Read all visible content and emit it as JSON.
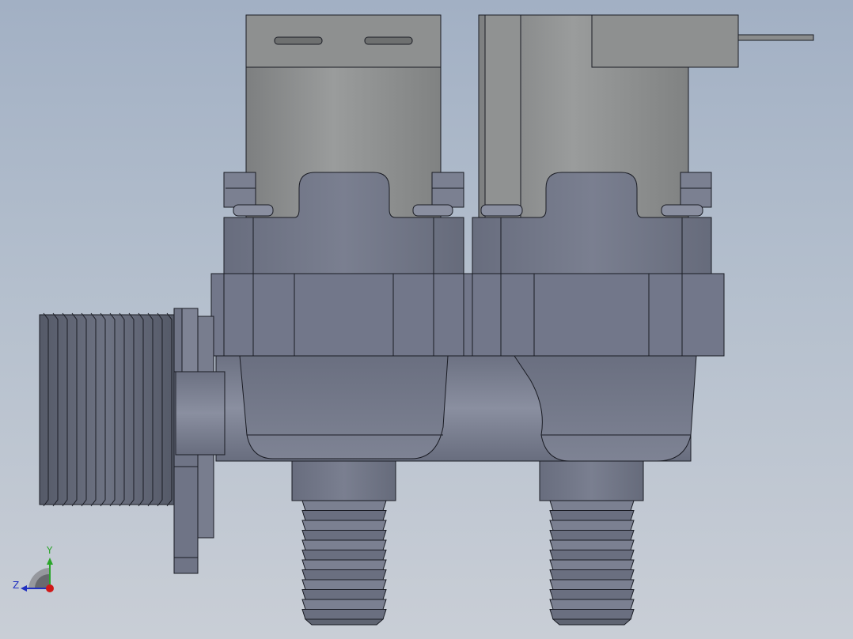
{
  "viewport": {
    "background_top": "#a2b0c4",
    "background_bottom": "#c9ced6"
  },
  "triad": {
    "y_label": "Y",
    "z_label": "Z",
    "y_color": "#2aa52a",
    "z_color": "#2030c0",
    "x_color": "#d01818"
  },
  "model": {
    "coil_color": "#8f9191",
    "body_color": "#6f7486",
    "body_light": "#7b8091",
    "thread_color": "#5f6472",
    "edge_color": "#1a1c24"
  }
}
